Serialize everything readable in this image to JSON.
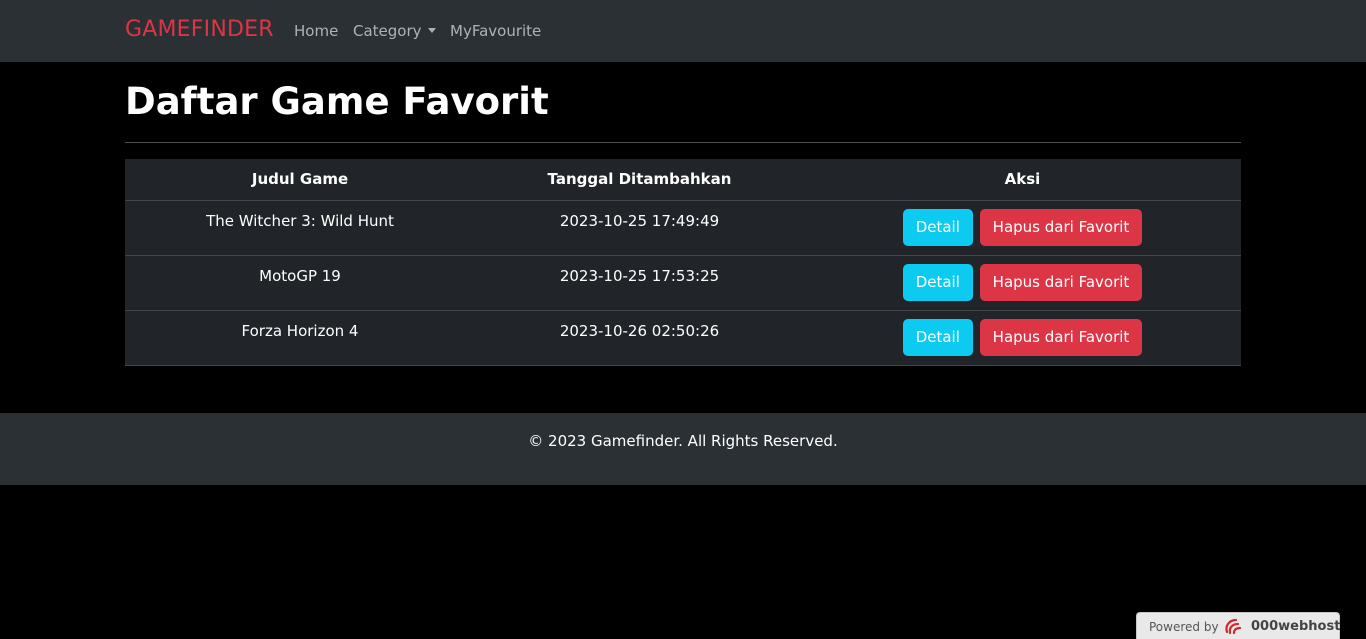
{
  "navbar": {
    "brand": "GAMEFINDER",
    "links": [
      {
        "label": "Home"
      },
      {
        "label": "Category"
      },
      {
        "label": "MyFavourite"
      }
    ]
  },
  "page_title": "Daftar Game Favorit",
  "table": {
    "headers": [
      "Judul Game",
      "Tanggal Ditambahkan",
      "Aksi"
    ],
    "rows": [
      {
        "title": "The Witcher 3: Wild Hunt",
        "date": "2023-10-25 17:49:49",
        "detail_label": "Detail",
        "remove_label": "Hapus dari Favorit"
      },
      {
        "title": "MotoGP 19",
        "date": "2023-10-25 17:53:25",
        "detail_label": "Detail",
        "remove_label": "Hapus dari Favorit"
      },
      {
        "title": "Forza Horizon 4",
        "date": "2023-10-26 02:50:26",
        "detail_label": "Detail",
        "remove_label": "Hapus dari Favorit"
      }
    ]
  },
  "footer": {
    "text": "© 2023 Gamefinder. All Rights Reserved."
  },
  "badge": {
    "powered_by": "Powered by",
    "host": "000webhost"
  },
  "colors": {
    "brand": "#dc3545",
    "detail_button": "#0dcaf0",
    "remove_button": "#dc3545",
    "navbar_bg": "#2b3035",
    "table_bg": "#212529"
  },
  "icons": {
    "category_dropdown": "chevron-down-icon",
    "host_logo": "000webhost-logo-icon"
  }
}
